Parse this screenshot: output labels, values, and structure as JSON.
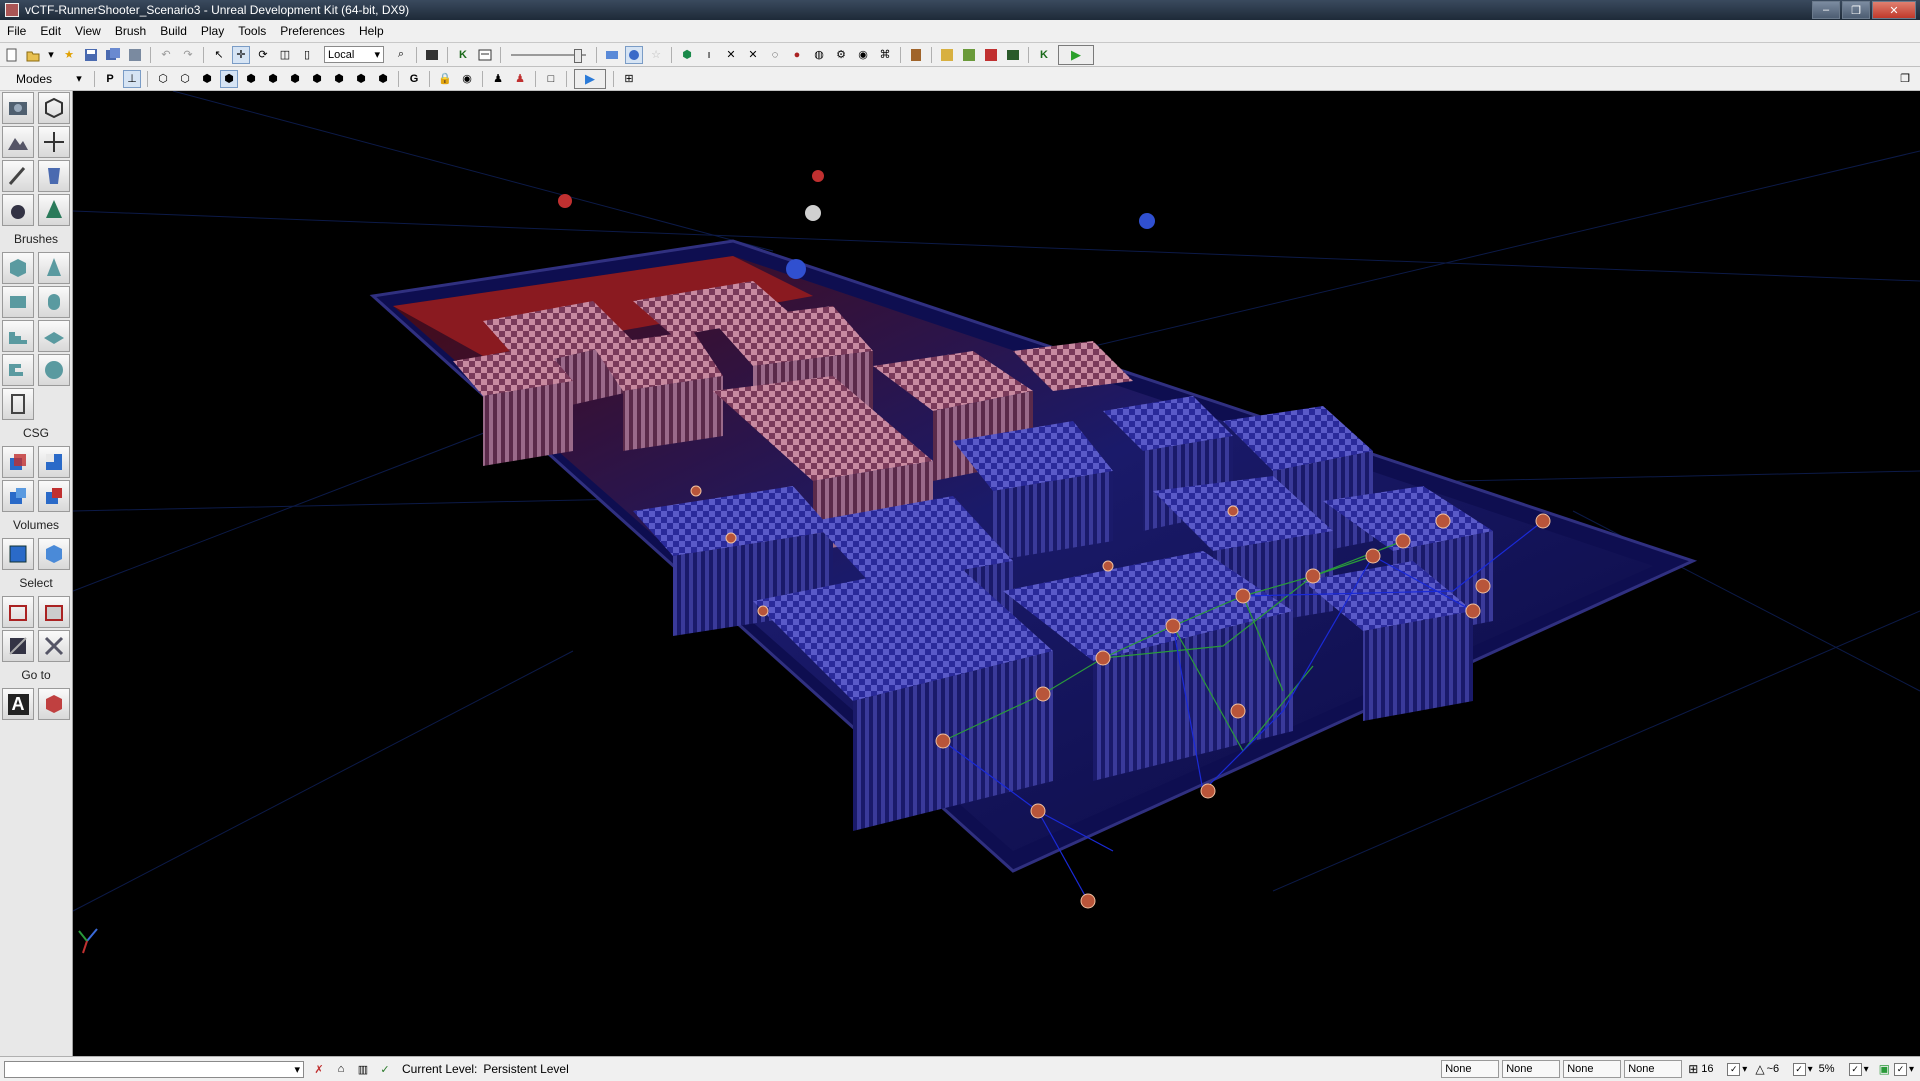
{
  "window": {
    "title": "vCTF-RunnerShooter_Scenario3 - Unreal Development Kit (64-bit, DX9)",
    "minimize": "–",
    "maximize": "❐",
    "close": "✕"
  },
  "menu": [
    "File",
    "Edit",
    "View",
    "Brush",
    "Build",
    "Play",
    "Tools",
    "Preferences",
    "Help"
  ],
  "toolbar": {
    "coord_system": "Local",
    "letter_k": "K",
    "play_glyph": "▶"
  },
  "toolbar2": {
    "modes_label": "Modes",
    "p_label": "P",
    "g_label": "G",
    "play_glyph": "▶"
  },
  "sidebar": {
    "brushes": "Brushes",
    "csg": "CSG",
    "volumes": "Volumes",
    "select": "Select",
    "goto": "Go to",
    "goto_a": "A"
  },
  "status": {
    "current_level_label": "Current Level:",
    "current_level": "Persistent Level",
    "none1": "None",
    "none2": "None",
    "none3": "None",
    "none4": "None",
    "grid_size": "16",
    "rotation_snap": "~6",
    "scale_snap": "5%"
  },
  "colors": {
    "accent_blue": "#2a3acf",
    "accent_red": "#c0282a",
    "play_green": "#2aa02a"
  }
}
